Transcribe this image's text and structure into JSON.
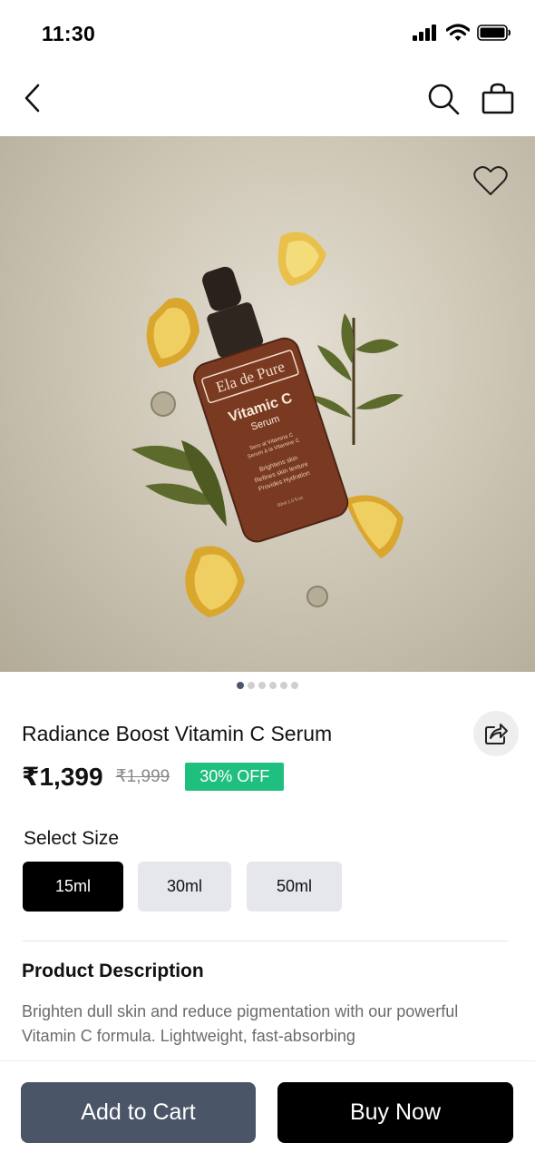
{
  "status_bar": {
    "time": "11:30",
    "icons": [
      "signal-icon",
      "wifi-icon",
      "battery-icon"
    ]
  },
  "nav": {
    "icons": [
      "back-arrow-icon",
      "search-icon",
      "shopping-bag-icon"
    ]
  },
  "hero": {
    "bottle_brand": "Ela de Pure",
    "bottle_name": "Vitamic C",
    "bottle_sub": "Serum",
    "bottle_small_1": "Sero al Vitamina C",
    "bottle_small_2": "Serum à la Vitamine C",
    "bottle_benefit_1": "Brightens skin",
    "bottle_benefit_2": "Refines skin texture",
    "bottle_benefit_3": "Provides Hydration",
    "bottle_volume": "30ml 1.0 fl.oz.",
    "carousel_total": 6,
    "carousel_active": 0,
    "wishlist_icon": "heart-outline-icon"
  },
  "product": {
    "title": "Radiance Boost Vitamin C Serum",
    "price": "₹1,399",
    "mrp": "₹1,999",
    "discount": "30% OFF",
    "share_icon": "share-icon"
  },
  "size": {
    "label": "Select Size",
    "options": [
      "15ml",
      "30ml",
      "50ml"
    ],
    "selected": "15ml"
  },
  "description": {
    "heading": "Product Description",
    "text": "Brighten dull skin and reduce pigmentation with our powerful Vitamin C formula.  Lightweight, fast-absorbing"
  },
  "actions": {
    "add_to_cart": "Add to Cart",
    "buy_now": "Buy Now"
  },
  "colors": {
    "accent_green": "#1fbf7f",
    "cart_button": "#4a5568",
    "buy_button": "#000000",
    "active_dot": "#4b5668"
  }
}
